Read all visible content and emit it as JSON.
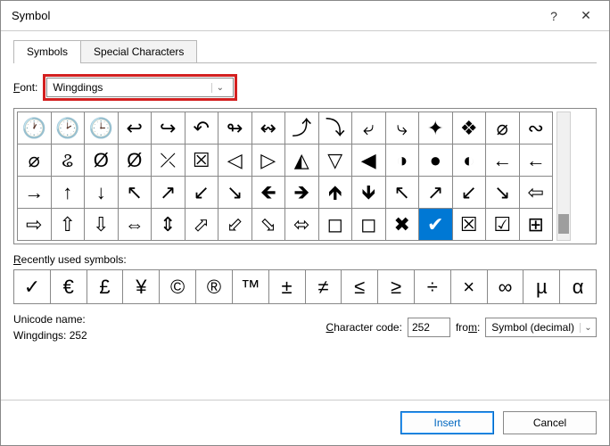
{
  "window": {
    "title": "Symbol"
  },
  "tabs": {
    "symbols": "Symbols",
    "special": "Special Characters"
  },
  "font": {
    "label_html": "Font:",
    "value": "Wingdings"
  },
  "grid": {
    "rows": [
      [
        "🕐",
        "🕑",
        "🕒",
        "↩",
        "↪",
        "↶",
        "↬",
        "↭",
        "⤴",
        "⤵",
        "⤶",
        "⤷",
        "✦",
        "❖",
        "⌀",
        "∾"
      ],
      [
        "⌀",
        "ଌ",
        "Ø",
        "Ø",
        "⤫",
        "☒",
        "◁",
        "▷",
        "◭",
        "▽",
        "◀",
        "◑",
        "●",
        "◐",
        "←",
        "←"
      ],
      [
        "→",
        "↑",
        "↓",
        "↖",
        "↗",
        "↙",
        "↘",
        "🡸",
        "🡺",
        "🡹",
        "🡻",
        "↖",
        "↗",
        "↙",
        "↘",
        "⇦"
      ],
      [
        "⇨",
        "⇧",
        "⇩",
        "⇔",
        "⇕",
        "⬀",
        "⬃",
        "⬂",
        "⬄",
        "◻",
        "◻",
        "✖",
        "✔",
        "☒",
        "☑",
        "⊞"
      ]
    ],
    "selected": {
      "row": 3,
      "col": 12
    }
  },
  "recent": {
    "label": "Recently used symbols:",
    "items": [
      "✓",
      "€",
      "£",
      "¥",
      "©",
      "®",
      "™",
      "±",
      "≠",
      "≤",
      "≥",
      "÷",
      "×",
      "∞",
      "µ",
      "α"
    ]
  },
  "unicode": {
    "label": "Unicode name:",
    "value": "Wingdings: 252"
  },
  "charcode": {
    "label": "Character code:",
    "value": "252"
  },
  "from": {
    "label": "from:",
    "value": "Symbol (decimal)"
  },
  "buttons": {
    "insert": "Insert",
    "cancel": "Cancel"
  }
}
